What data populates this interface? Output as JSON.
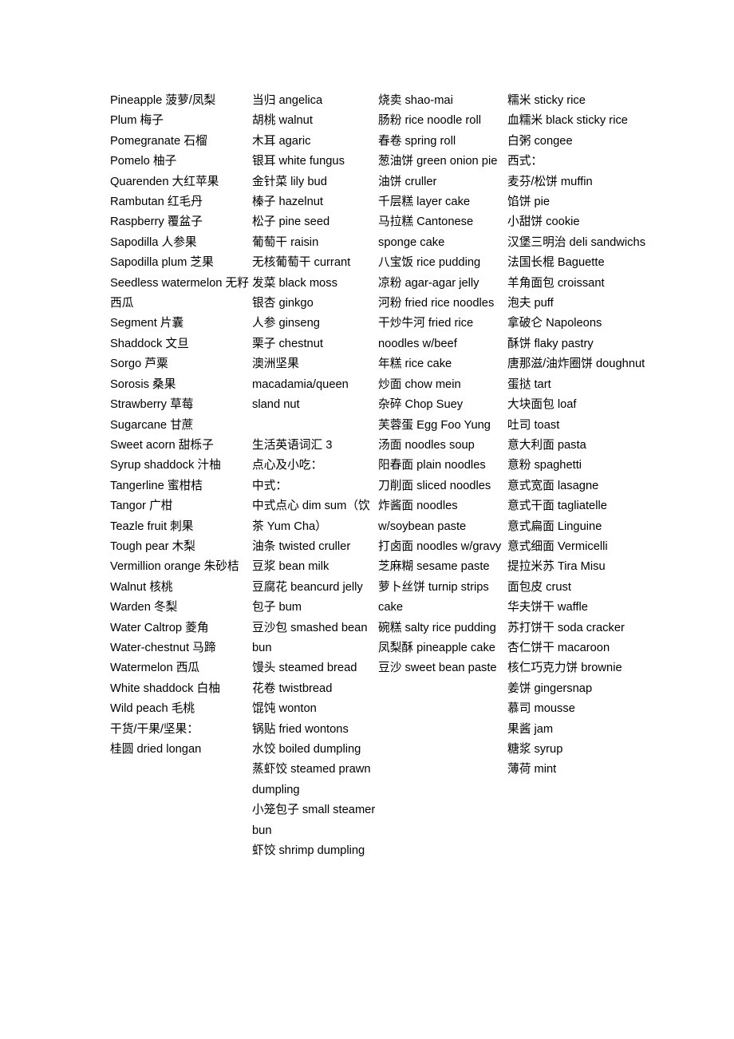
{
  "document": {
    "title": "生活英语词汇 3",
    "background_color": "#ffffff",
    "text_color": "#000000"
  },
  "columns": [
    {
      "name": "column-fruits",
      "entries": [
        "Pineapple 菠萝/凤梨",
        "Plum 梅子",
        "Pomegranate 石榴",
        "Pomelo 柚子",
        "Quarenden 大红苹果",
        "Rambutan 红毛丹",
        "Raspberry 覆盆子",
        "Sapodilla 人参果",
        "Sapodilla plum 芝果",
        "Seedless watermelon 无籽西瓜",
        "Segment 片囊",
        "Shaddock 文旦",
        "Sorgo 芦粟",
        "Sorosis 桑果",
        "Strawberry 草莓",
        "Sugarcane 甘蔗",
        "Sweet acorn 甜栎子",
        "Syrup shaddock 汁柚",
        "Tangerline 蜜柑桔",
        "Tangor 广柑",
        "Teazle fruit 刺果",
        "Tough pear 木梨",
        "Vermillion orange 朱砂桔",
        "Walnut 核桃",
        "Warden 冬梨",
        "Water Caltrop 菱角",
        "Water-chestnut 马蹄",
        "Watermelon 西瓜",
        "White shaddock 白柚",
        "Wild peach 毛桃",
        "干货/干果/坚果：",
        "桂圆 dried longan"
      ]
    },
    {
      "name": "column-nuts-and-dimsum",
      "entries": [
        "当归 angelica",
        "胡桃 walnut",
        "木耳 agaric",
        "银耳 white fungus",
        "金针菜 lily bud",
        "榛子 hazelnut",
        "松子 pine seed",
        "葡萄干 raisin",
        "无核葡萄干 currant",
        "发菜 black moss",
        "银杏 ginkgo",
        "人参 ginseng",
        "栗子 chestnut",
        "澳洲坚果 macadamia/queen sland nut",
        "",
        "生活英语词汇 3",
        "点心及小吃：",
        "中式：",
        "中式点心 dim sum（饮茶 Yum Cha）",
        "油条 twisted cruller",
        "豆浆 bean milk",
        "豆腐花 beancurd jelly",
        "包子 bum",
        "豆沙包 smashed bean bun",
        "馒头 steamed bread",
        "花卷 twistbread",
        "馄饨 wonton",
        "锅贴 fried wontons",
        "水饺 boiled dumpling",
        "蒸虾饺 steamed prawn dumpling",
        "小笼包子 small steamer bun",
        "虾饺 shrimp dumpling"
      ]
    },
    {
      "name": "column-chinese-snacks",
      "entries": [
        "烧卖 shao-mai",
        "肠粉 rice noodle roll",
        "春卷 spring roll",
        "葱油饼 green onion pie",
        "油饼 cruller",
        "千层糕 layer cake",
        "马拉糕 Cantonese sponge cake",
        "八宝饭 rice pudding",
        "凉粉 agar-agar jelly",
        "河粉 fried rice noodles",
        "干炒牛河 fried rice noodles w/beef",
        "年糕 rice cake",
        "炒面 chow mein",
        "杂碎 Chop Suey",
        "芙蓉蛋 Egg Foo Yung",
        "汤面 noodles soup",
        "阳春面 plain noodles",
        "刀削面 sliced noodles",
        "炸酱面 noodles w/soybean paste",
        "打卤面 noodles w/gravy",
        "芝麻糊 sesame paste",
        "萝卜丝饼 turnip strips cake",
        "碗糕 salty rice pudding",
        "凤梨酥 pineapple cake",
        "豆沙 sweet bean paste"
      ]
    },
    {
      "name": "column-western-snacks",
      "entries": [
        "糯米 sticky rice",
        "血糯米 black sticky rice",
        "白粥 congee",
        "西式：",
        "麦芬/松饼 muffin",
        "馅饼 pie",
        "小甜饼 cookie",
        "汉堡三明治 deli sandwichs",
        "法国长棍 Baguette",
        "羊角面包 croissant",
        "泡夫 puff",
        "拿破仑 Napoleons",
        "酥饼 flaky pastry",
        "唐那滋/油炸圈饼 doughnut",
        "蛋挞 tart",
        "大块面包 loaf",
        "吐司 toast",
        "意大利面 pasta",
        "意粉 spaghetti",
        "意式宽面 lasagne",
        "意式干面 tagliatelle",
        "意式扁面 Linguine",
        "意式细面 Vermicelli",
        "提拉米苏 Tira Misu",
        "面包皮 crust",
        "华夫饼干 waffle",
        "苏打饼干 soda cracker",
        "杏仁饼干 macaroon",
        "核仁巧克力饼 brownie",
        "姜饼 gingersnap",
        "慕司 mousse",
        "果酱 jam",
        "糖浆 syrup",
        "薄荷 mint"
      ]
    }
  ]
}
